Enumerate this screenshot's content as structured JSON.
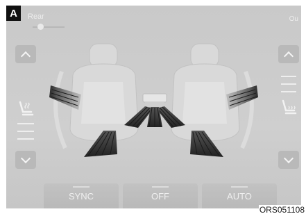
{
  "badge": {
    "label": "A"
  },
  "header": {
    "zone_label": "Rear",
    "right_label": "Ou",
    "rear_slider_level": 0.25
  },
  "controls": {
    "left": {
      "up_icon": "chevron-up-icon",
      "down_icon": "chevron-down-icon",
      "seat_icon": "seat-heat-icon",
      "level_bars": 3
    },
    "right": {
      "up_icon": "chevron-up-icon",
      "down_icon": "chevron-down-icon",
      "seat_icon": "seat-heat-icon",
      "level_bars": 3
    }
  },
  "buttons": {
    "sync": "SYNC",
    "off": "OFF",
    "auto": "AUTO"
  },
  "figure_code": "ORS051108",
  "colors": {
    "screen_bg": "#cbcbcb",
    "button_bg": "#bcbcbc",
    "text_light": "#efefef",
    "airflow_dark": "#333333"
  }
}
